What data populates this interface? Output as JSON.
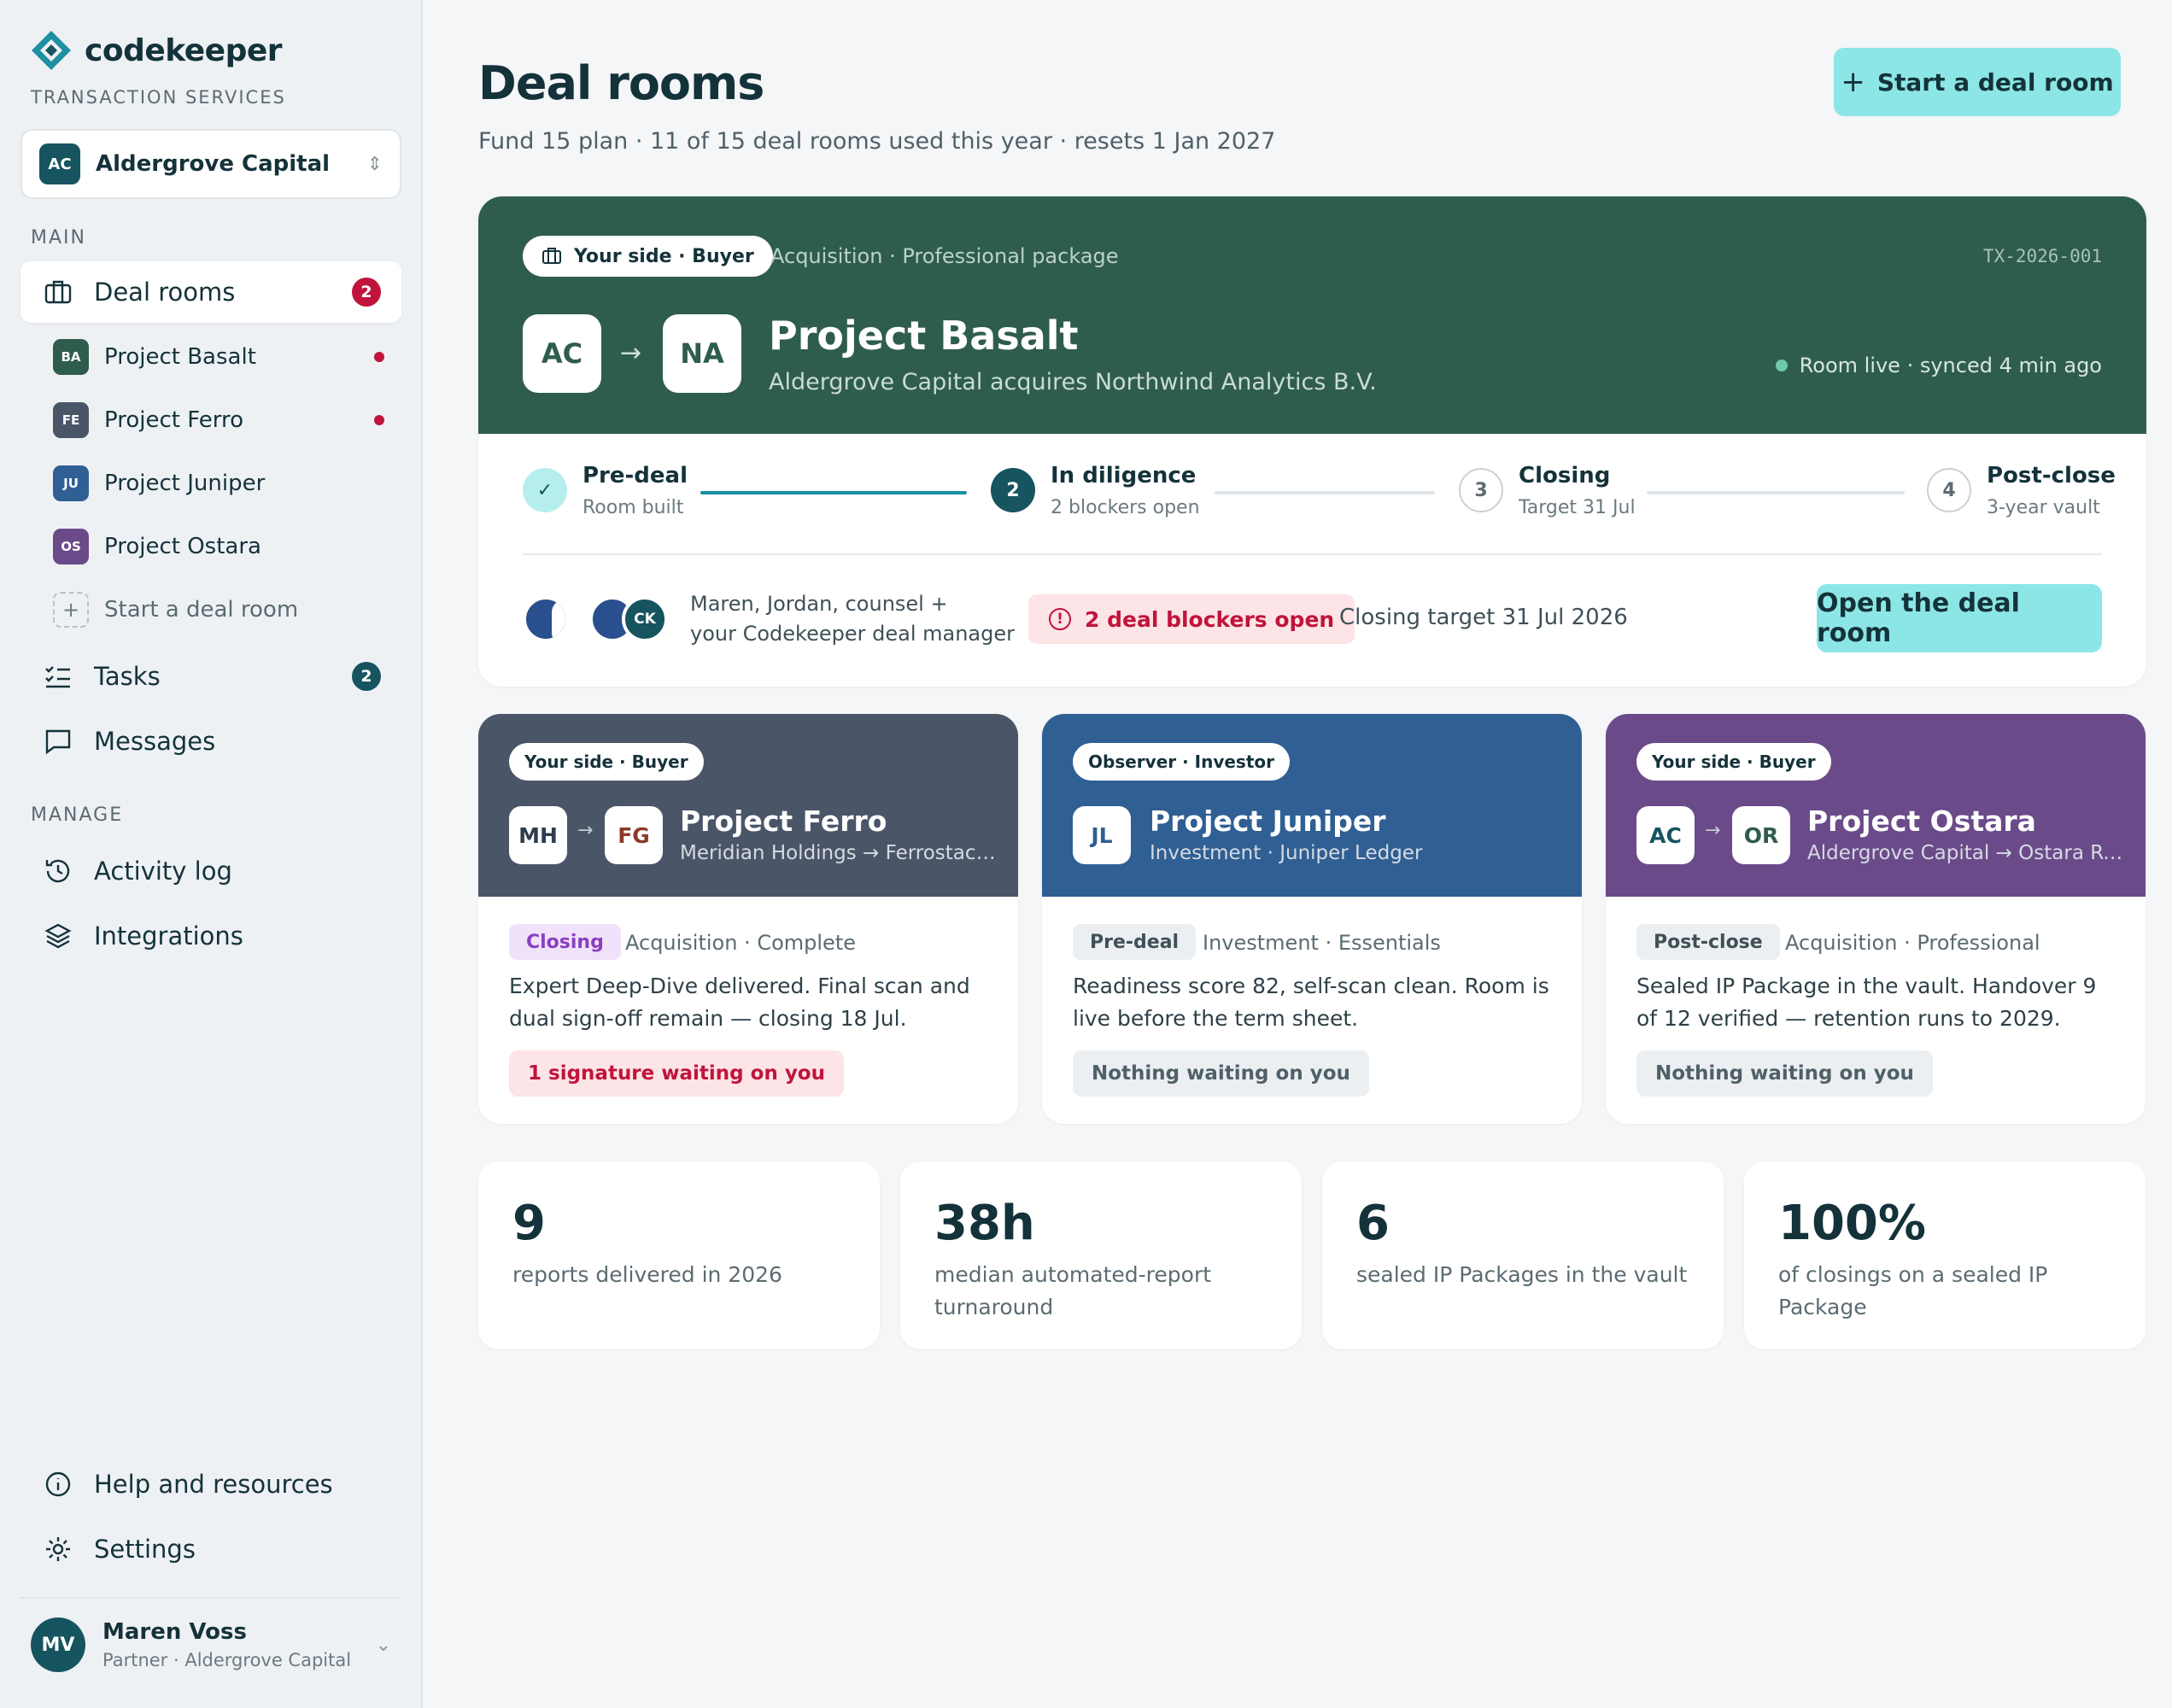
{
  "brand": {
    "name": "codekeeper",
    "subtitle": "TRANSACTION SERVICES"
  },
  "org": {
    "initials": "AC",
    "name": "Aldergrove Capital"
  },
  "sidebar": {
    "main_label": "MAIN",
    "manage_label": "MANAGE",
    "deal_rooms": {
      "label": "Deal rooms",
      "badge": "2"
    },
    "projects": [
      {
        "initials": "BA",
        "name": "Project Basalt",
        "color": "#2f5d4d",
        "dot": true
      },
      {
        "initials": "FE",
        "name": "Project Ferro",
        "color": "#4a5568",
        "dot": true
      },
      {
        "initials": "JU",
        "name": "Project Juniper",
        "color": "#2f5f93",
        "dot": false
      },
      {
        "initials": "OS",
        "name": "Project Ostara",
        "color": "#6b4a8a",
        "dot": false
      }
    ],
    "start_label": "Start a deal room",
    "tasks": {
      "label": "Tasks",
      "badge": "2"
    },
    "messages": {
      "label": "Messages"
    },
    "activity": {
      "label": "Activity log"
    },
    "integrations": {
      "label": "Integrations"
    },
    "help": {
      "label": "Help and resources"
    },
    "settings": {
      "label": "Settings"
    }
  },
  "user": {
    "initials": "MV",
    "name": "Maren Voss",
    "role": "Partner · Aldergrove Capital"
  },
  "header": {
    "title": "Deal rooms",
    "subtitle": "Fund 15 plan · 11 of 15 deal rooms used this year · resets 1 Jan 2027",
    "start_button": "Start a deal room"
  },
  "hero": {
    "side": "Your side · Buyer",
    "package": "Acquisition · Professional package",
    "txid": "TX-2026-001",
    "from": "AC",
    "to": "NA",
    "name": "Project Basalt",
    "desc": "Aldergrove Capital acquires Northwind Analytics B.V.",
    "live": "Room live · synced 4 min ago",
    "steps": [
      {
        "num": "",
        "title": "Pre-deal",
        "sub": "Room built"
      },
      {
        "num": "2",
        "title": "In diligence",
        "sub": "2 blockers open"
      },
      {
        "num": "3",
        "title": "Closing",
        "sub": "Target 31 Jul"
      },
      {
        "num": "4",
        "title": "Post-close",
        "sub": "3-year vault"
      }
    ],
    "ck": "CK",
    "people_line1": "Maren, Jordan, counsel +",
    "people_line2": "your Codekeeper deal manager",
    "blockers": "2 deal blockers open",
    "closing": "Closing target 31 Jul 2026",
    "open_button": "Open the deal room"
  },
  "cards": [
    {
      "side": "Your side · Buyer",
      "from": "MH",
      "to": "FG",
      "name": "Project Ferro",
      "sub": "Meridian Holdings → Ferrostack ...",
      "tag": "Closing",
      "kind": "Acquisition · Complete",
      "desc": "Expert Deep-Dive delivered. Final scan and dual sign-off remain — closing 18 Jul.",
      "chip": "1 signature waiting on you",
      "color": "#4a5568"
    },
    {
      "side": "Observer · Investor",
      "from": "JL",
      "to": "",
      "name": "Project Juniper",
      "sub": "Investment · Juniper Ledger",
      "tag": "Pre-deal",
      "kind": "Investment · Essentials",
      "desc": "Readiness score 82, self-scan clean. Room is live before the term sheet.",
      "chip": "Nothing waiting on you",
      "color": "#2f5f93"
    },
    {
      "side": "Your side · Buyer",
      "from": "AC",
      "to": "OR",
      "name": "Project Ostara",
      "sub": "Aldergrove Capital → Ostara Ro...",
      "tag": "Post-close",
      "kind": "Acquisition · Professional",
      "desc": "Sealed IP Package in the vault. Handover 9 of 12 verified — retention runs to 2029.",
      "chip": "Nothing waiting on you",
      "color": "#6b4a8a"
    }
  ],
  "stats": [
    {
      "value": "9",
      "label": "reports delivered in 2026"
    },
    {
      "value": "38h",
      "label": "median automated-report turnaround"
    },
    {
      "value": "6",
      "label": "sealed IP Packages in the vault"
    },
    {
      "value": "100%",
      "label": "of closings on a sealed IP Package"
    }
  ]
}
